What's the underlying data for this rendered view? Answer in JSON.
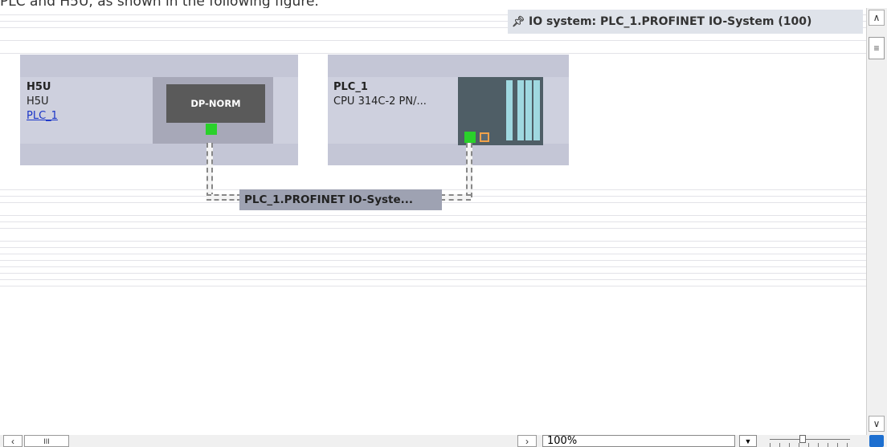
{
  "caption": "PLC and H5U, as shown in the following figure.",
  "io_system": {
    "label": "IO system: PLC_1.PROFINET IO-System (100)",
    "icon": "pin-icon"
  },
  "devices": [
    {
      "name": "H5U",
      "type": "H5U",
      "link": "PLC_1",
      "module_label": "DP-NORM"
    },
    {
      "name": "PLC_1",
      "type": "CPU 314C-2 PN/..."
    }
  ],
  "network": {
    "label": "PLC_1.PROFINET IO-Syste..."
  },
  "scrollbar": {
    "up_icon": "chevron-up-icon",
    "down_icon": "chevron-down-icon",
    "left_icon": "chevron-left-icon",
    "right_icon": "chevron-right-icon",
    "thumb_glyph": "≡",
    "hthumb_glyph": "III"
  },
  "zoom": {
    "value": "100%",
    "slider_level": 0.4
  },
  "colors": {
    "port": "#2ad12a",
    "link": "#1a35c8",
    "device_bg": "#ced0de",
    "network_label_bg": "#9ea2b2"
  }
}
